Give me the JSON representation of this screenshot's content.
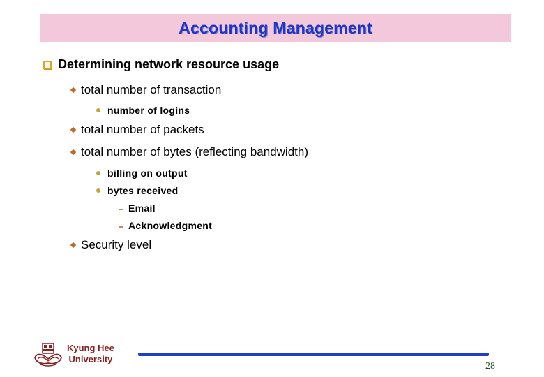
{
  "slide": {
    "title": "Accounting Management",
    "page_number": "28",
    "colors": {
      "title_bar_bg": "#f2c8da",
      "title_text": "#1f35c8",
      "footer_line": "#1c3fd0",
      "university_text": "#8b1e1e"
    }
  },
  "content": {
    "heading": {
      "icon": "hollow-square-bullet",
      "text": "Determining network resource usage"
    },
    "items": [
      {
        "text": "total number of transaction",
        "icon": "diamond-bullet"
      },
      {
        "text": "number of logins",
        "icon": "dot-bullet"
      },
      {
        "text": "total number of packets",
        "icon": "diamond-bullet"
      },
      {
        "text": "total number of bytes (reflecting bandwidth)",
        "icon": "diamond-bullet"
      },
      {
        "text": "billing on output",
        "icon": "dot-bullet"
      },
      {
        "text": "bytes received",
        "icon": "dot-bullet"
      },
      {
        "text": "Email",
        "icon": "dash-bullet"
      },
      {
        "text": "Acknowledgment",
        "icon": "dash-bullet"
      },
      {
        "text": "Security level",
        "icon": "diamond-bullet"
      }
    ]
  },
  "footer": {
    "university_line1": "Kyung Hee",
    "university_line2": "University",
    "logo": "university-crest-icon"
  }
}
